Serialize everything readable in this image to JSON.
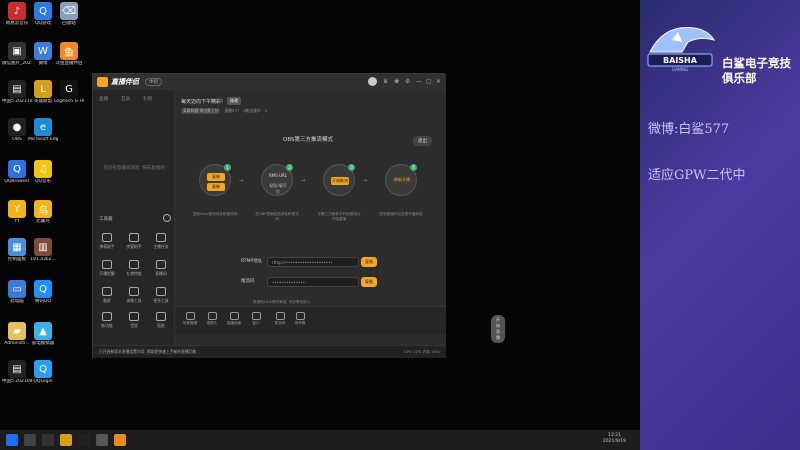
{
  "desktop": {
    "icons": [
      {
        "label": "网易云音乐",
        "color": "#c62f2f",
        "glyph": "♪"
      },
      {
        "label": "QQ游戏",
        "color": "#2c7be5",
        "glyph": "Q"
      },
      {
        "label": "回收站",
        "color": "#8aa0b8",
        "glyph": "⌫"
      },
      {
        "label": "微信图片_20211215...",
        "color": "#333333",
        "glyph": "▣"
      },
      {
        "label": "微博",
        "color": "#3b7dd8",
        "glyph": "W"
      },
      {
        "label": "斗鱼直播伴侣",
        "color": "#f08a24",
        "glyph": "鱼"
      },
      {
        "label": "中国5 20211023...",
        "color": "#222222",
        "glyph": "▤"
      },
      {
        "label": "英雄联盟",
        "color": "#d4a015",
        "glyph": "L"
      },
      {
        "label": "Logitech G HUB",
        "color": "#111111",
        "glyph": "G"
      },
      {
        "label": "OBS",
        "color": "#222222",
        "glyph": "●"
      },
      {
        "label": "Microsoft Edge",
        "color": "#1f8ad8",
        "glyph": "e"
      },
      {
        "label": "QQBrowser",
        "color": "#2f6fe0",
        "glyph": "Q"
      },
      {
        "label": "QQ音乐",
        "color": "#f2c511",
        "glyph": "♫"
      },
      {
        "label": "YY",
        "color": "#f0b41c",
        "glyph": "Y"
      },
      {
        "label": "比翼鸟",
        "color": "#f0b41c",
        "glyph": "鸟"
      },
      {
        "label": "控制面板",
        "color": "#4a90d9",
        "glyph": "▦"
      },
      {
        "label": "191.a3b2...",
        "color": "#7a4a3a",
        "glyph": "▥"
      },
      {
        "label": "此电脑",
        "color": "#3a7bd5",
        "glyph": "▭"
      },
      {
        "label": "腾讯QQ",
        "color": "#1e90ff",
        "glyph": "Q"
      },
      {
        "label": "Administr...",
        "color": "#e8c15a",
        "glyph": "▰"
      },
      {
        "label": "雷电模拟器",
        "color": "#3cb0e8",
        "glyph": "▲"
      },
      {
        "label": "中国5 20210920...",
        "color": "#222222",
        "glyph": "▤"
      },
      {
        "label": "QQLogin",
        "color": "#2a9df4",
        "glyph": "Q"
      }
    ]
  },
  "app": {
    "title": "直播伴侣",
    "version": "体验",
    "controls": [
      "♛",
      "♚",
      "⚙",
      "—",
      "▢",
      "✕"
    ],
    "left": {
      "tabs": [
        "直播",
        "互动",
        "礼物"
      ],
      "empty_text": "还没有直播间消息, 快去直播吧",
      "tools_header": "工具箱",
      "tools": [
        {
          "label": "弹幕助手"
        },
        {
          "label": "房管助手"
        },
        {
          "label": "主播任务"
        },
        {
          "label": "开播提醒"
        },
        {
          "label": "礼物特效"
        },
        {
          "label": "直播间"
        },
        {
          "label": "截屏"
        },
        {
          "label": "录像工具"
        },
        {
          "label": "更多工具"
        },
        {
          "label": "新功能"
        },
        {
          "label": "音效"
        },
        {
          "label": "贴纸"
        }
      ]
    },
    "main": {
      "room_title": "每天迈向下午精彩!",
      "room_button": "修改",
      "meta_tags": [
        "英雄联盟·排位赛上分"
      ],
      "meta_stats": [
        "直播577",
        "0粉丝观众",
        "0"
      ],
      "mode_title": "OBS第三方推流模式",
      "back_label": "退出",
      "steps": [
        {
          "num": "1",
          "top": "复制",
          "bottom": "复制",
          "desc": "复制rtmp推流地址和推流码"
        },
        {
          "num": "2",
          "top": "RMS URL",
          "bottom": "粘贴/填写后",
          "desc": "在OBS里面粘贴地址和推流码"
        },
        {
          "num": "3",
          "top": "开始推流",
          "bottom": "",
          "desc": "在第三方软件中开始推流以开始直播"
        },
        {
          "num": "4",
          "top": "刷新开播",
          "bottom": "",
          "desc": "回到直播伴侣查看开播状态"
        }
      ],
      "rtmp_label": "RTMP地址",
      "rtmp_value": "rtmp://••••••••••••••••••••",
      "key_label": "推流码",
      "key_value": "••••••••••••••",
      "copy_label": "复制",
      "hint": "推流码24小时内有效, 不分享给他人"
    },
    "bottom": {
      "items": [
        "场景管理",
        "摄像头",
        "直播画面",
        "窗口",
        "麦克风",
        "扬声器"
      ],
      "go_live": "开始直播"
    },
    "status": {
      "text": "已开启新版本直播设置向导, 帮助您快速上手新的直播功能",
      "right": "CPU 12%  内存 45%"
    }
  },
  "sidepanel": {
    "club": "白鲨电子竞技俱乐部",
    "weibo": "微博:白鲨577",
    "gpw": "适应GPW二代中",
    "logo_text": "BAISHA",
    "logo_sub": "GAMING",
    "colors": {
      "accent": "#4b3aa0",
      "logo": "#9ec2ff"
    }
  },
  "taskbar": {
    "time": "13:21",
    "date": "2021/9/19"
  }
}
